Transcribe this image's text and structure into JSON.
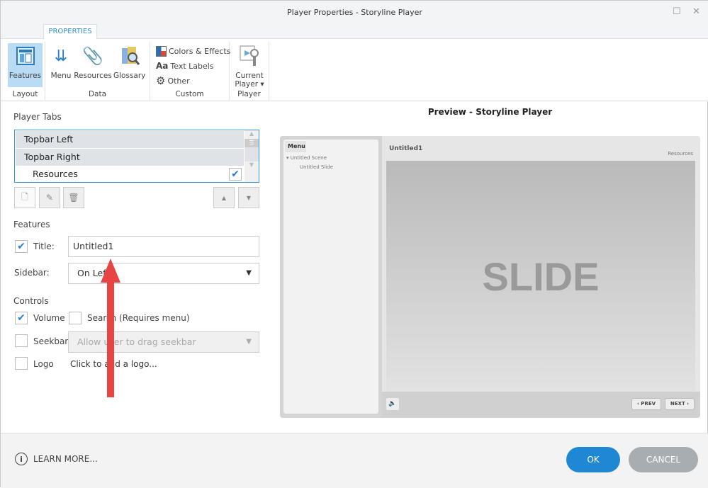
{
  "window": {
    "title": "Player Properties - Storyline Player"
  },
  "ribbon": {
    "tab": "PROPERTIES",
    "buttons": {
      "features": "Features",
      "menu": "Menu",
      "resources": "Resources",
      "glossary": "Glossary",
      "colors": "Colors & Effects",
      "text_labels": "Text Labels",
      "other": "Other",
      "current_player_1": "Current",
      "current_player_2": "Player"
    },
    "groups": {
      "layout": "Layout",
      "data": "Data",
      "custom": "Custom",
      "player": "Player"
    }
  },
  "player_tabs": {
    "heading": "Player Tabs",
    "items": [
      {
        "label": "Topbar Left"
      },
      {
        "label": "Topbar Right"
      },
      {
        "label": "Resources",
        "checked": true
      }
    ]
  },
  "features": {
    "heading": "Features",
    "title_label": "Title:",
    "title_value": "Untitled1",
    "title_checked": true,
    "sidebar_label": "Sidebar:",
    "sidebar_value": "On Left"
  },
  "controls": {
    "heading": "Controls",
    "volume": "Volume",
    "volume_checked": true,
    "search": "Search (Requires menu)",
    "seekbar": "Seekbar",
    "seekbar_option": "Allow user to drag seekbar",
    "logo": "Logo",
    "logo_link": "Click to add a logo..."
  },
  "preview": {
    "heading": "Preview - Storyline Player",
    "menu_tab": "Menu",
    "scene": "Untitled Scene",
    "slide": "Untitled Slide",
    "title": "Untitled1",
    "resources": "Resources",
    "slide_text": "SLIDE",
    "prev": "PREV",
    "next": "NEXT"
  },
  "footer": {
    "learn_more": "LEARN MORE...",
    "ok": "OK",
    "cancel": "CANCEL"
  },
  "colors": {
    "accent": "#1e88d5",
    "cancel": "#a8adb2",
    "arrow": "#e84444"
  }
}
